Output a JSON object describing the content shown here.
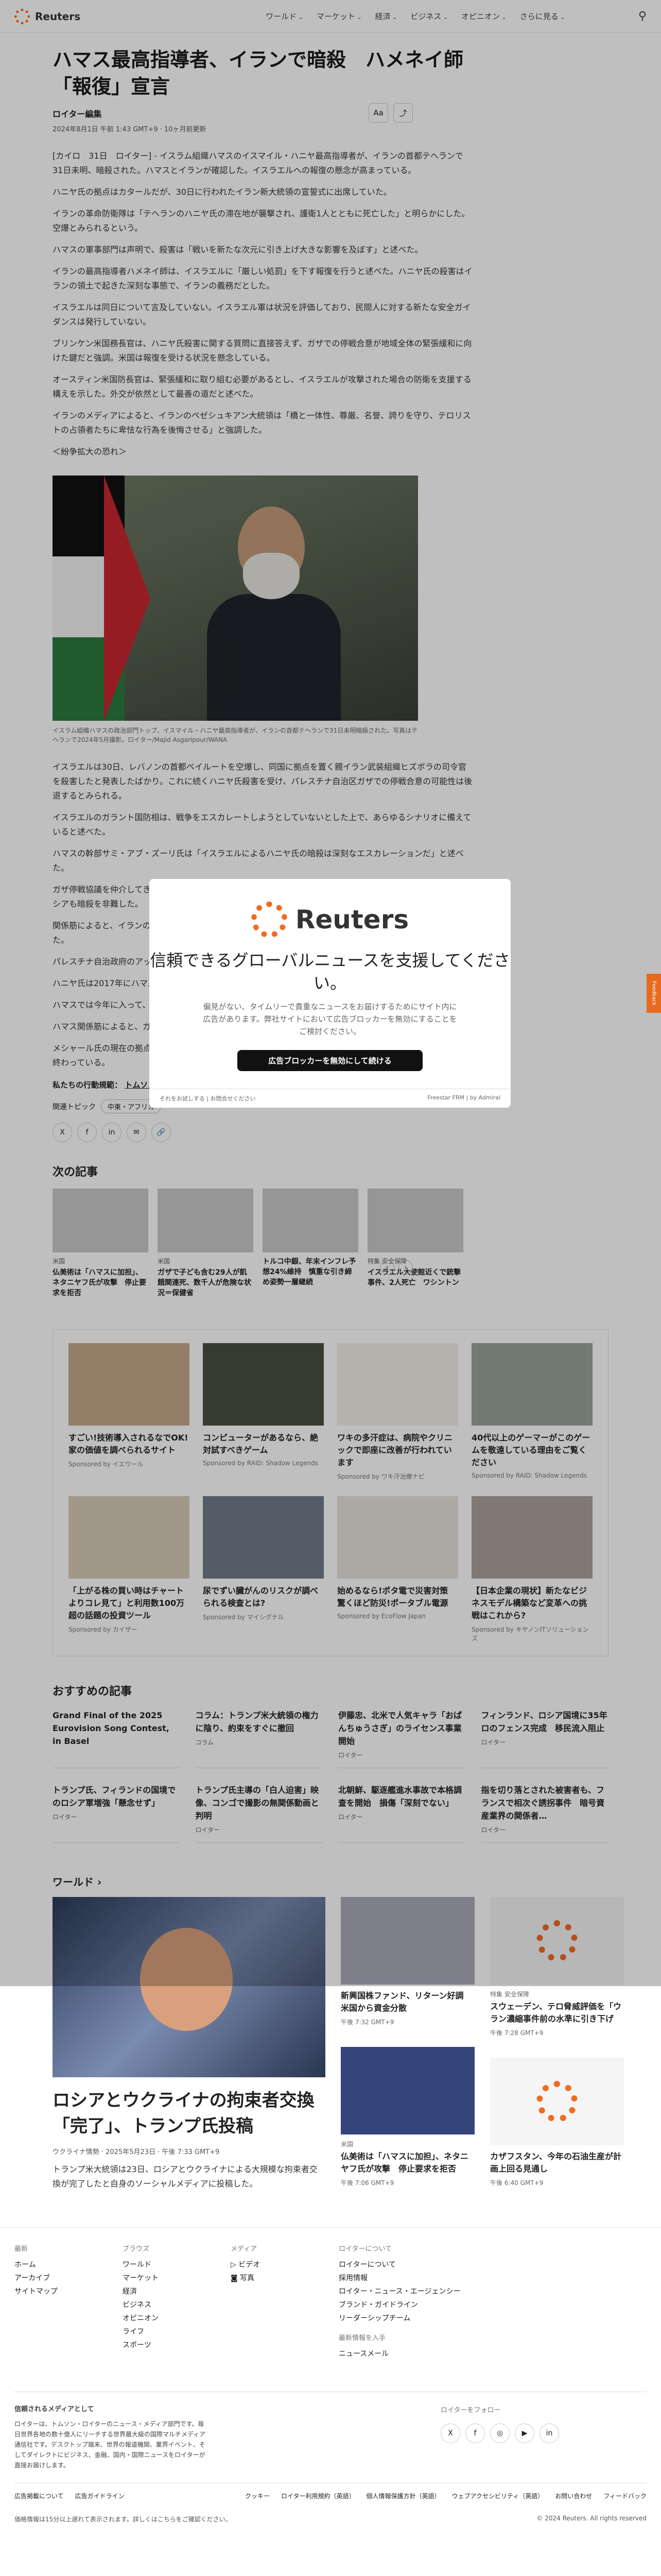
{
  "header": {
    "brand": "Reuters",
    "nav": [
      "ワールド",
      "マーケット",
      "経済",
      "ビジネス",
      "オピニオン",
      "さらに見る"
    ]
  },
  "article": {
    "title": "ハマス最高指導者、イランで暗殺　ハメネイ師「報復」宣言",
    "author": "ロイター編集",
    "date": "2024年8月1日 午前 1:43 GMT+9 · 10ヶ月前更新",
    "text_size": "Aa",
    "paragraphs": [
      "[カイロ　31日　ロイター] - イスラム組織ハマスのイスマイル・ハニヤ最高指導者が、イランの首都テヘランで31日未明、暗殺された。ハマスとイランが確認した。イスラエルへの報復の懸念が高まっている。",
      "ハニヤ氏の拠点はカタールだが、30日に行われたイラン新大統領の宣誓式に出席していた。",
      "イランの革命防衛隊は「テヘランのハニヤ氏の滞在地が襲撃され、護衛1人とともに死亡した」と明らかにした。空爆とみられるという。",
      "ハマスの軍事部門は声明で、殺害は「戦いを新たな次元に引き上げ大きな影響を及ぼす」と述べた。",
      "イランの最高指導者ハメネイ師は、イスラエルに「厳しい処罰」を下す報復を行うと述べた。ハニヤ氏の殺害はイランの領土で起きた深刻な事態で、イランの義務だとした。",
      "イスラエルは同日について言及していない。イスラエル軍は状況を評価しており、民間人に対する新たな安全ガイダンスは発行していない。",
      "ブリンケン米国務長官は、ハニヤ氏殺害に関する質問に直接答えず、ガザでの停戦合意が地域全体の緊張緩和に向けた鍵だと強調。米国は報復を受ける状況を懸念している。",
      "オースティン米国防長官は、緊張緩和に取り組む必要があるとし、イスラエルが攻撃された場合の防衛を支援する構えを示した。外交が依然として最善の道だと述べた。",
      "イランのメディアによると、イランのペゼシュキアン大統領は「橋と一体性、尊厳、名誉、誇りを守り、テロリストの占領者たちに卑怯な行為を後悔させる」と強調した。",
      "＜紛争拡大の恐れ＞"
    ],
    "image_caption": "イスラム組織ハマスの政治部門トップ、イスマイル・ハニヤ最高指導者が、イランの首都テヘランで31日未明暗殺された。写真はテヘランで2024年5月撮影。ロイター/Majid Asgaripour/WANA",
    "paragraphs2": [
      "イスラエルは30日、レバノンの首都ベイルートを空爆し、同国に拠点を置く親イラン武装組織ヒズボラの司令官を殺害したと発表したばかり。これに続くハニヤ氏殺害を受け、パレスチナ自治区ガザでの停戦合意の可能性は後退するとみられる。",
      "イスラエルのガラント国防相は、戦争をエスカレートしようとしていないとした上で、あらゆるシナリオに備えていると述べた。",
      "ハマスの幹部サミ・アブ・ズーリ氏は「イスラエルによるハニヤ氏の暗殺は深刻なエスカレーションだ」と述べた。",
      "ガザ停戦協議を仲介してきたカタールの首相は、交渉相手が殺害される中で交渉はどう進むのかと非難。中国、ロシアも暗殺を非難した。",
      "関係筋によると、イランの最高国家安全保障会議が緊急会合を開き、ハメネイ師がイスラエルへの直接攻撃を命じた。",
      "パレスチナ自治政府のアッバス議長は、ハニヤ氏殺害を「卑劣な行為」と非難し、ゼネストを呼び掛けた。",
      "ハニヤ氏は2017年にハマス最高指導者に就任。カタールを拠点に停戦交渉などで外交的役割を担ってきた。",
      "ハマスでは今年に入って、ガザ地区の軍事部門を率いるムハンマド・デイフ司令官の死亡も確認されている。",
      "ハマス関係筋によると、ガザの指導者ヤヒヤ・シンワル氏が後継になる可能性もある。",
      "メシャール氏の現在の拠点はカタール。1997年にイスラエルのネタニヤフ首相が同氏の暗殺を命じたが、未遂に終わっている。"
    ],
    "related_prefix": "私たちの行動規範：",
    "related_link": "トムソン・ロイター「信頼の原則」",
    "topics_label": "関連トピック",
    "topics": [
      "中東・アフリカ"
    ]
  },
  "next": {
    "title": "次の記事",
    "items": [
      {
        "cat": "米国",
        "title": "仏美術は「ハマスに加担」、ネタニヤフ氏が攻撃　停止要求を拒否"
      },
      {
        "cat": "米国",
        "title": "ガザで子ども含む29人が飢餓関連死、数千人が危険な状況＝保健省"
      },
      {
        "cat": "",
        "title": "トルコ中銀、年末インフレ予想24%維持　慎重な引き締め姿勢一層継続"
      },
      {
        "cat": "特集 安全保障",
        "title": "イスラエル大使館近くで銃撃事件、2人死亡　ワシントン"
      }
    ]
  },
  "ads": [
    {
      "title": "すごい!技術導入されるなでOK!家の価値を調べられるサイト",
      "sp": "Sponsored by イエウール"
    },
    {
      "title": "コンピューターがあるなら、絶対試すべきゲーム",
      "sp": "Sponsored by RAID: Shadow Legends"
    },
    {
      "title": "ワキの多汗症は、病院やクリニックで即座に改善が行われています",
      "sp": "Sponsored by ワキ汗治療ナビ"
    },
    {
      "title": "40代以上のゲーマーがこのゲームを敬遠している理由をご覧ください",
      "sp": "Sponsored by RAID: Shadow Legends"
    },
    {
      "title": "「上がる株の買い時はチャートよりコレ見て」と利用数100万超の話題の投資ツール",
      "sp": "Sponsored by カイザー"
    },
    {
      "title": "尿でずい臓がんのリスクが調べられる検査とは?",
      "sp": "Sponsored by マイシグナル"
    },
    {
      "title": "始めるなら!ポタ電で災害対策 驚くほど防災!ポータブル電源",
      "sp": "Sponsored by EcoFlow Japan"
    },
    {
      "title": "【日本企業の現状】新たなビジネスモデル構築など変革への挑戦はこれから?",
      "sp": "Sponsored by キヤノンITソリューションズ"
    }
  ],
  "recommended": {
    "title": "おすすめの記事",
    "items": [
      {
        "title": "Grand Final of the 2025 Eurovision Song Contest, in Basel",
        "sub": ""
      },
      {
        "title": "コラム：トランプ米大統領の権力に陰り、約束をすぐに撤回",
        "sub": "コラム"
      },
      {
        "title": "伊藤忠、北米で人気キャラ「おぱんちゅうさぎ」のライセンス事業開始",
        "sub": "ロイター"
      },
      {
        "title": "フィンランド、ロシア国境に35年ロのフェンス完成　移民流入阻止",
        "sub": "ロイター"
      },
      {
        "title": "トランプ氏、フィランドの国境でのロシア軍増強「懸念せず」",
        "sub": "ロイター"
      },
      {
        "title": "トランプ氏主導の「白人迫害」映像、コンゴで撮影の無関係動画と判明",
        "sub": "ロイター"
      },
      {
        "title": "北朝鮮、駆逐艦進水事故で本格調査を開始　損傷「深刻でない」",
        "sub": "ロイター"
      },
      {
        "title": "指を切り落とされた被害者も、フランスで相次ぐ誘拐事件　暗号資産業界の関係者…",
        "sub": "ロイター"
      }
    ]
  },
  "world": {
    "title": "ワールド",
    "lead": {
      "headline": "ロシアとウクライナの拘束者交換「完了」、トランプ氏投稿",
      "meta": "ウクライナ情勢 · 2025年5月23日 · 午後 7:33 GMT+9",
      "summary": "トランプ米大統領は23日、ロシアとウクライナによる大規模な拘束者交換が完了したと自身のソーシャルメディアに投稿した。"
    },
    "side": [
      {
        "cat": "",
        "title": "新興国株ファンド、リターン好調　米国から資金分散",
        "time": "午後 7:32 GMT+9"
      },
      {
        "cat": "特集 安全保障",
        "title": "スウェーデン、テロ脅威評価を「ウラン濃縮事件前の水準に引き下げ",
        "time": "午後 7:28 GMT+9"
      },
      {
        "cat": "米国",
        "title": "仏美術は「ハマスに加担」、ネタニヤフ氏が攻撃　停止要求を拒否",
        "time": "午後 7:06 GMT+9"
      },
      {
        "cat": "",
        "title": "カザフスタン、今年の石油生産が計画上回る見通し",
        "time": "午後 6:40 GMT+9"
      }
    ]
  },
  "footer": {
    "col1_title": "最新",
    "col1": [
      "ホーム",
      "アーカイブ",
      "サイトマップ"
    ],
    "col2_title": "ブラウズ",
    "col2": [
      "ワールド",
      "マーケット",
      "経済",
      "ビジネス",
      "オピニオン",
      "ライフ",
      "スポーツ"
    ],
    "col3_title": "メディア",
    "col3": [
      "ビデオ",
      "写真"
    ],
    "col4_title": "ロイターについて",
    "col4": [
      "ロイターについて",
      "採用情報",
      "ロイター・ニュース・エージェンシー",
      "ブランド・ガイドライン",
      "リーダーシップチーム"
    ],
    "col5_title": "最新情報を入手",
    "col5": [
      "ニュースメール"
    ],
    "about_title": "信頼されるメディアとして",
    "about": "ロイターは、トムソン・ロイターのニュース・メディア部門です。毎日世界各地の数十億人にリーチする世界最大級の国際マルチメディア通信社です。デスクトップ端末、世界の報道機関、業界イベント、そしてダイレクトにビジネス、金融、国内・国際ニュースをロイターが直接お届けします。",
    "follow": "ロイターをフォロー",
    "legal": [
      "広告掲載について",
      "広告ガイドライン",
      "クッキー",
      "ロイター利用規約（英語）",
      "個人情報保護方針（英語）",
      "ウェブアクセシビリティ（英語）",
      "お問い合わせ",
      "フィードバック"
    ],
    "note": "価格情報は15分以上遅れて表示されます。詳しくはこちらをご確認ください。",
    "copyright": "© 2024 Reuters. All rights reserved"
  },
  "modal": {
    "brand": "Reuters",
    "headline": "信頼できるグローバルニュースを支援してください。",
    "text": "偏見がない、タイムリーで貴重なニュースをお届けするためにサイト内に広告があります。弊社サイトにおいて広告ブロッカーを無効にすることをご検討ください。",
    "button": "広告ブロッカーを無効にして続ける",
    "foot_left": "それをお試しする | お問合せください",
    "foot_right": "Freestar FRM | by Admiral"
  },
  "feedback": "Feedback"
}
